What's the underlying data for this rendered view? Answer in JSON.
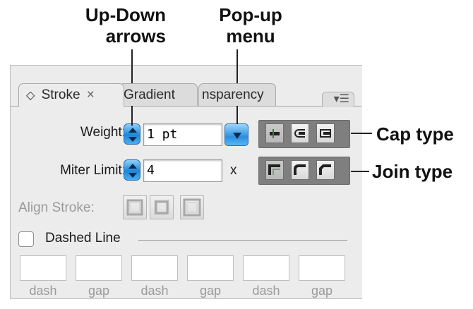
{
  "callouts": {
    "up_down_line1": "Up-Down",
    "up_down_line2": "arrows",
    "popup_line1": "Pop-up",
    "popup_line2": "menu",
    "cap_type": "Cap type",
    "join_type": "Join type"
  },
  "tabs": {
    "stroke": "Stroke",
    "gradient": "Gradient",
    "transparency": "nsparency"
  },
  "icons": {
    "tab_toggle": "◇",
    "tab_close": "×",
    "panel_menu": "▾☰"
  },
  "weight": {
    "label": "Weight:",
    "value": "1 pt"
  },
  "miter": {
    "label": "Miter Limit:",
    "value": "4",
    "suffix": "x"
  },
  "align": {
    "label": "Align Stroke:"
  },
  "dashed": {
    "label": "Dashed Line",
    "checked": false,
    "fields": [
      "dash",
      "gap",
      "dash",
      "gap",
      "dash",
      "gap"
    ]
  },
  "colors": {
    "accent_blue": "#1d86db",
    "panel_bg": "#ececec"
  }
}
